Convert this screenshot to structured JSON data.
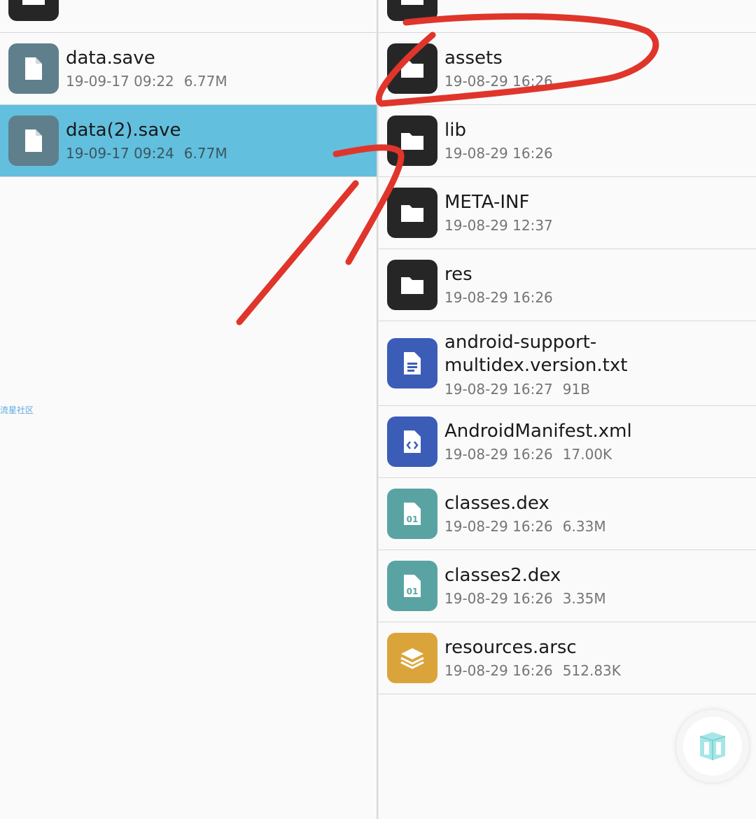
{
  "left_pane": {
    "items": [
      {
        "name": "",
        "date": "",
        "size": "",
        "icon": "folder-icon"
      },
      {
        "name": "data.save",
        "date": "19-09-17 09:22",
        "size": "6.77M",
        "icon": "file-icon"
      },
      {
        "name": "data(2).save",
        "date": "19-09-17 09:24",
        "size": "6.77M",
        "icon": "file-icon",
        "selected": true
      }
    ],
    "watermark": "流星社区"
  },
  "right_pane": {
    "items": [
      {
        "name": "",
        "date": "",
        "size": "",
        "icon": "folder-icon"
      },
      {
        "name": "assets",
        "date": "19-08-29 16:26",
        "size": "",
        "icon": "folder-icon"
      },
      {
        "name": "lib",
        "date": "19-08-29 16:26",
        "size": "",
        "icon": "folder-icon"
      },
      {
        "name": "META-INF",
        "date": "19-08-29 12:37",
        "size": "",
        "icon": "folder-icon"
      },
      {
        "name": "res",
        "date": "19-08-29 16:26",
        "size": "",
        "icon": "folder-icon"
      },
      {
        "name": "android-support-multidex.version.txt",
        "date": "19-08-29 16:27",
        "size": "91B",
        "icon": "text-file-icon"
      },
      {
        "name": "AndroidManifest.xml",
        "date": "19-08-29 16:26",
        "size": "17.00K",
        "icon": "code-file-icon"
      },
      {
        "name": "classes.dex",
        "date": "19-08-29 16:26",
        "size": "6.33M",
        "icon": "binary-file-icon"
      },
      {
        "name": "classes2.dex",
        "date": "19-08-29 16:26",
        "size": "3.35M",
        "icon": "binary-file-icon"
      },
      {
        "name": "resources.arsc",
        "date": "19-08-29 16:26",
        "size": "512.83K",
        "icon": "layers-file-icon"
      }
    ]
  },
  "fab": {
    "icon": "cube-icon"
  },
  "colors": {
    "selected_row": "#62bfde",
    "folder_icon_bg": "#262626",
    "file_icon_bg": "#5f7f8c",
    "text_icon_bg": "#3b5db8",
    "binary_icon_bg": "#5aa3a3",
    "arsc_icon_bg": "#dba43a",
    "annotation": "#e0352b"
  }
}
